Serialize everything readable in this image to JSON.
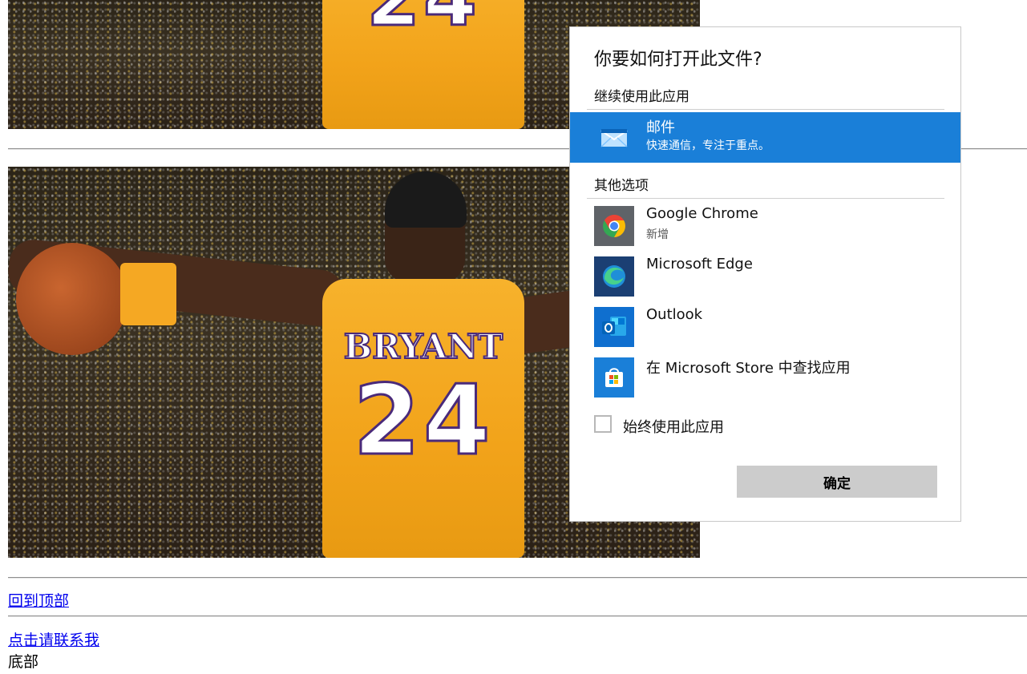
{
  "page": {
    "back_to_top_link": "回到顶部",
    "contact_link": "点击请联系我",
    "footer_text": "底部",
    "jersey_number": "24",
    "jersey_name": "BRYANT"
  },
  "dialog": {
    "title": "你要如何打开此文件?",
    "keep_using_label": "继续使用此应用",
    "other_options_label": "其他选项",
    "selected_app": {
      "name": "邮件",
      "subtitle": "快速通信，专注于重点。",
      "icon": "mail-icon"
    },
    "apps": [
      {
        "name": "Google Chrome",
        "subtitle": "新增",
        "icon": "chrome-icon"
      },
      {
        "name": "Microsoft Edge",
        "subtitle": "",
        "icon": "edge-icon"
      },
      {
        "name": "Outlook",
        "subtitle": "",
        "icon": "outlook-icon"
      },
      {
        "name": "在 Microsoft Store 中查找应用",
        "subtitle": "",
        "icon": "store-icon"
      }
    ],
    "always_use_label": "始终使用此应用",
    "always_use_checked": false,
    "ok_button_label": "确定",
    "accent_color": "#1a7fd8"
  }
}
